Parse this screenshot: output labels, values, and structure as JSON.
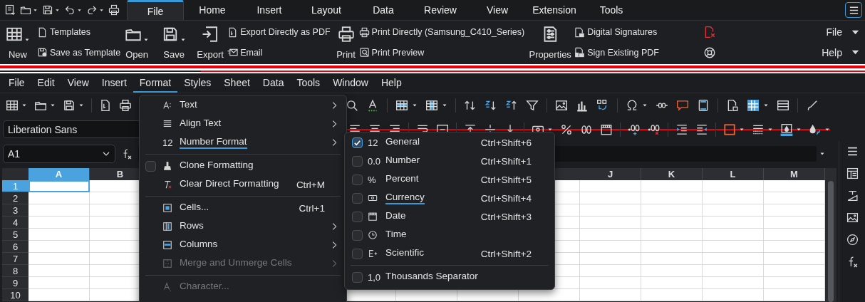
{
  "ribbon_tabs": [
    {
      "label": "File",
      "selected": true
    },
    {
      "label": "Home",
      "selected": false
    },
    {
      "label": "Insert",
      "selected": false
    },
    {
      "label": "Layout",
      "selected": false
    },
    {
      "label": "Data",
      "selected": false
    },
    {
      "label": "Review",
      "selected": false
    },
    {
      "label": "View",
      "selected": false
    },
    {
      "label": "Extension",
      "selected": false
    },
    {
      "label": "Tools",
      "selected": false
    }
  ],
  "ribbon": {
    "new": "New",
    "templates": "Templates",
    "save_as_template": "Save as Template",
    "open": "Open",
    "save": "Save",
    "export": "Export",
    "export_pdf": "Export Directly as PDF",
    "email": "Email",
    "print": "Print",
    "print_directly": "Print Directly (Samsung_C410_Series)",
    "print_preview": "Print Preview",
    "properties": "Properties",
    "digital_signatures": "Digital Signatures",
    "sign_existing_pdf": "Sign Existing PDF",
    "file_menu": "File",
    "help_menu": "Help"
  },
  "menubar": [
    {
      "label": "File",
      "selected": false
    },
    {
      "label": "Edit",
      "selected": false
    },
    {
      "label": "View",
      "selected": false
    },
    {
      "label": "Insert",
      "selected": false
    },
    {
      "label": "Format",
      "selected": true
    },
    {
      "label": "Styles",
      "selected": false
    },
    {
      "label": "Sheet",
      "selected": false
    },
    {
      "label": "Data",
      "selected": false
    },
    {
      "label": "Tools",
      "selected": false
    },
    {
      "label": "Window",
      "selected": false
    },
    {
      "label": "Help",
      "selected": false
    }
  ],
  "font_name": "Liberation Sans",
  "name_box": "A1",
  "format_menu": [
    {
      "kind": "submenu",
      "label": "Text",
      "disabled": false,
      "highlighted": false
    },
    {
      "kind": "submenu",
      "label": "Align Text",
      "disabled": false,
      "highlighted": false
    },
    {
      "kind": "submenu",
      "glyph": "12",
      "label": "Number Format",
      "disabled": false,
      "highlighted": true
    },
    {
      "kind": "separator"
    },
    {
      "kind": "check",
      "label": "Clone Formatting",
      "checked": false,
      "disabled": false,
      "highlighted": false
    },
    {
      "kind": "action",
      "label": "Clear Direct Formatting",
      "shortcut": "Ctrl+M",
      "disabled": false,
      "highlighted": false
    },
    {
      "kind": "separator"
    },
    {
      "kind": "action",
      "label": "Cells...",
      "shortcut": "Ctrl+1",
      "disabled": false,
      "highlighted": false
    },
    {
      "kind": "submenu",
      "label": "Rows",
      "disabled": false,
      "highlighted": false
    },
    {
      "kind": "submenu",
      "label": "Columns",
      "disabled": false,
      "highlighted": false
    },
    {
      "kind": "submenu",
      "label": "Merge and Unmerge Cells",
      "disabled": true,
      "highlighted": false
    },
    {
      "kind": "separator"
    },
    {
      "kind": "action",
      "label": "Character...",
      "disabled": true,
      "highlighted": false
    }
  ],
  "number_format_menu": [
    {
      "kind": "option",
      "glyph": "12",
      "label": "General",
      "shortcut": "Ctrl+Shift+6",
      "checked": true,
      "highlighted": false
    },
    {
      "kind": "option",
      "glyph": "0.0",
      "label": "Number",
      "shortcut": "Ctrl+Shift+1",
      "checked": false,
      "highlighted": false
    },
    {
      "kind": "option",
      "glyph": "%",
      "label": "Percent",
      "shortcut": "Ctrl+Shift+5",
      "checked": false,
      "highlighted": false
    },
    {
      "kind": "option",
      "label": "Currency",
      "shortcut": "Ctrl+Shift+4",
      "checked": false,
      "highlighted": true
    },
    {
      "kind": "option",
      "label": "Date",
      "shortcut": "Ctrl+Shift+3",
      "checked": false,
      "highlighted": false
    },
    {
      "kind": "option",
      "label": "Time",
      "checked": false,
      "highlighted": false
    },
    {
      "kind": "option",
      "label": "Scientific",
      "shortcut": "Ctrl+Shift+2",
      "checked": false,
      "highlighted": false
    },
    {
      "kind": "separator"
    },
    {
      "kind": "option",
      "glyph": "1,0",
      "label": "Thousands Separator",
      "checked": false,
      "highlighted": false
    }
  ],
  "columns_left": [
    {
      "label": "A",
      "selected": true
    },
    {
      "label": "B",
      "selected": false
    }
  ],
  "columns_right": [
    {
      "label": "J",
      "selected": false
    },
    {
      "label": "K",
      "selected": false
    },
    {
      "label": "L",
      "selected": false
    },
    {
      "label": "M",
      "selected": false
    }
  ],
  "rows": [
    {
      "label": "1",
      "selected": true
    },
    {
      "label": "2",
      "selected": false
    },
    {
      "label": "3",
      "selected": false
    },
    {
      "label": "4",
      "selected": false
    },
    {
      "label": "5",
      "selected": false
    },
    {
      "label": "6",
      "selected": false
    },
    {
      "label": "7",
      "selected": false
    },
    {
      "label": "8",
      "selected": false
    },
    {
      "label": "9",
      "selected": false
    },
    {
      "label": "10",
      "selected": false
    }
  ]
}
